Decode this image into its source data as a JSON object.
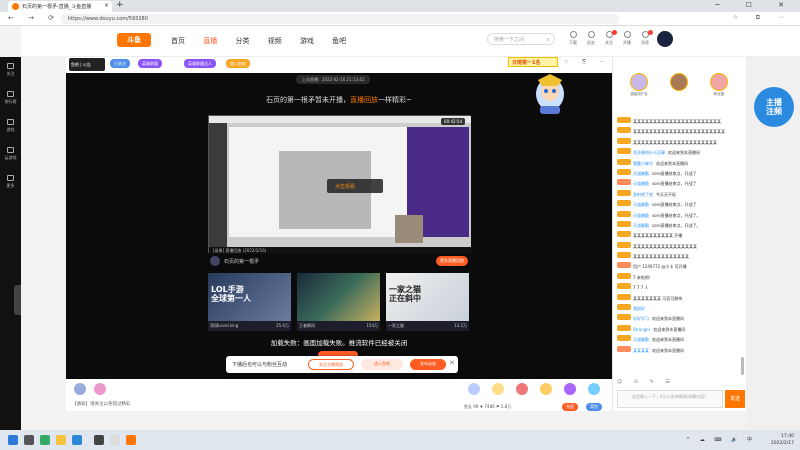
{
  "browser": {
    "tab_title": "石页的第一根矛-直播_斗鱼直播",
    "new_tab": "+",
    "url": "https://www.douyu.com/593280",
    "window_controls": "─ ☐ ✕"
  },
  "header": {
    "logo_text": "斗鱼",
    "menu": [
      "首页",
      "直播",
      "分类",
      "视频",
      "游戏",
      "鱼吧"
    ],
    "search_placeholder": "搜索一下之间",
    "icons": [
      {
        "name": "download-icon",
        "label": "下载"
      },
      {
        "name": "history-icon",
        "label": "历史"
      },
      {
        "name": "follow-icon",
        "label": "关注"
      },
      {
        "name": "start-live-icon",
        "label": "开播"
      },
      {
        "name": "message-icon",
        "label": "消息"
      },
      {
        "name": "task-icon",
        "label": "任务"
      }
    ]
  },
  "sidebar": {
    "items": [
      "关注",
      "排行榜",
      "游戏",
      "云游戏",
      "更多"
    ]
  },
  "anchor": {
    "card_name": "鱼吧 | 公告",
    "tags": [
      "已关注",
      "英雄联盟",
      "英雄联盟达人",
      "加入粉丝"
    ],
    "rank": "日榜第一1名",
    "bar_icons": "☆ ⎘ ⋯"
  },
  "player": {
    "live_time": "上次直播：2022-02-16 21:13:41",
    "offline_prefix": "石页的第一根矛暂未开播，",
    "offline_link": "直播回放",
    "offline_suffix": "一样精彩~",
    "video_badge": "00:42:54",
    "video_label": "点击观看",
    "video_bottom": "[录像] 直播回放 (2022/2/16)",
    "replay_anchor": "石页的第一根矛",
    "replay_button": "更多直播回放",
    "recs": [
      {
        "big": "LOL手游\n全球第一人",
        "cap": "洞洞Level.king",
        "cnt": "25.6万"
      },
      {
        "big": "",
        "cap": "王者瞬间",
        "cnt": "154万"
      },
      {
        "big": "一家之猫\n正在斜中",
        "cap": "一家之猫",
        "cnt": "13.2万"
      }
    ],
    "fail_text": "加载失败：画面加载失败。推流软件已经被关闭"
  },
  "float_bar": {
    "text": "下播后也可以与粉丝互动",
    "btn1": "关注主播频道",
    "btn2": "进入鱼吧",
    "btn3": "发布动态",
    "close": "✕"
  },
  "bottom": {
    "notice": "【通知】请关注以免错过精彩",
    "stats": "鱼丸  99    ♦ 7486    ⚑ 3.8万",
    "btn_charge": "充值",
    "btn_bag": "背包"
  },
  "chat": {
    "rank_users": [
      "超级用户名",
      "",
      "粉丝团"
    ],
    "messages": [
      {
        "user": "",
        "text": "某某某某某某某某某某某某某某某某某某某某某某"
      },
      {
        "user": "",
        "text": "某某某某某某某某某某某某某某某某某某某某某某某"
      },
      {
        "user": "",
        "text": "某某某某某某某某某某某某某某某某某某某某某"
      },
      {
        "user": "洗洗睡吧什么回事",
        "text": "欢迎来到本直播间"
      },
      {
        "user": "雷霆小辉仔",
        "text": "欢迎来到本直播间"
      },
      {
        "user": "天道酬勤",
        "text": "sore直播结束点，开战了"
      },
      {
        "user": "天道酬勤",
        "text": "sore直播结束点，开战了"
      },
      {
        "user": "发射吧了吧",
        "text": "今天天不彩"
      },
      {
        "user": "天道酬勤",
        "text": "sore直播结束点，开战了"
      },
      {
        "user": "天道酬勤",
        "text": "sore直播结束点，开战了。"
      },
      {
        "user": "天道酬勤",
        "text": "sore直播结束点，开战了。"
      },
      {
        "user": "",
        "text": "某某某某某某某某某某    开播"
      },
      {
        "user": "",
        "text": "某某某某某某某某某某某某某某某某"
      },
      {
        "user": "",
        "text": "某某某某某某某某某某某某某某"
      },
      {
        "user": "",
        "text": "用户 1249772  @小卡 可开播"
      },
      {
        "user": "",
        "text": "7 来啦吧！"
      },
      {
        "user": "",
        "text": "7 7 7 人"
      },
      {
        "user": "",
        "text": "某某某某某某某   可否可期待"
      },
      {
        "user": "我很好",
        "text": ""
      },
      {
        "user": "好好学习",
        "text": "欢迎来到本直播间"
      },
      {
        "user": "Stranger",
        "text": "欢迎来到本直播间"
      },
      {
        "user": "天道酬勤",
        "text": "欢迎来到本直播间"
      },
      {
        "user": "某某某某",
        "text": "欢迎来到本直播间"
      }
    ],
    "tools": "☺ ⊙ ✎ ☰",
    "input_placeholder": "这里输入一下，K可以发弹幕喔(弹幕内容)",
    "send": "发送"
  },
  "promo": {
    "text": "主播\n注频"
  },
  "taskbar": {
    "time": "17:40",
    "date": "2022/2/17",
    "tray": "^ ☁ ⌨ 🔊 中"
  },
  "colors": {
    "accent": "#ff5d23",
    "brand": "#ff7700",
    "link": "#2b94ff"
  }
}
